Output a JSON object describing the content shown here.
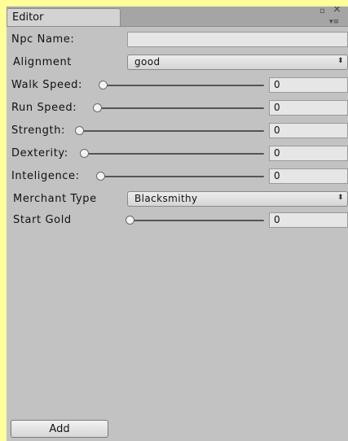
{
  "window": {
    "tab_title": "Editor",
    "max_icon": "▫",
    "close_icon": "×",
    "menu_icon": "▾≡"
  },
  "form": {
    "npc_name": {
      "label": "Npc Name:",
      "value": ""
    },
    "alignment": {
      "label": "Alignment",
      "selected": "good"
    },
    "walk_speed": {
      "label": "Walk Speed:",
      "value": "0",
      "level": 0
    },
    "run_speed": {
      "label": "Run Speed:",
      "value": "0",
      "level": 0
    },
    "strength": {
      "label": "Strength:",
      "value": "0",
      "level": 0
    },
    "dexterity": {
      "label": "Dexterity:",
      "value": "0",
      "level": 0
    },
    "inteligence": {
      "label": "Inteligence:",
      "value": "0",
      "level": 0
    },
    "merchant_type": {
      "label": "Merchant Type",
      "selected": "Blacksmithy"
    },
    "start_gold": {
      "label": "Start Gold",
      "value": "0",
      "level": 0
    }
  },
  "dropdown_arrow": "⬍",
  "add_button": {
    "label": "Add"
  },
  "colors": {
    "background": "#ffff99",
    "panel": "#c2c2c2",
    "tab": "#d3d3d3"
  }
}
